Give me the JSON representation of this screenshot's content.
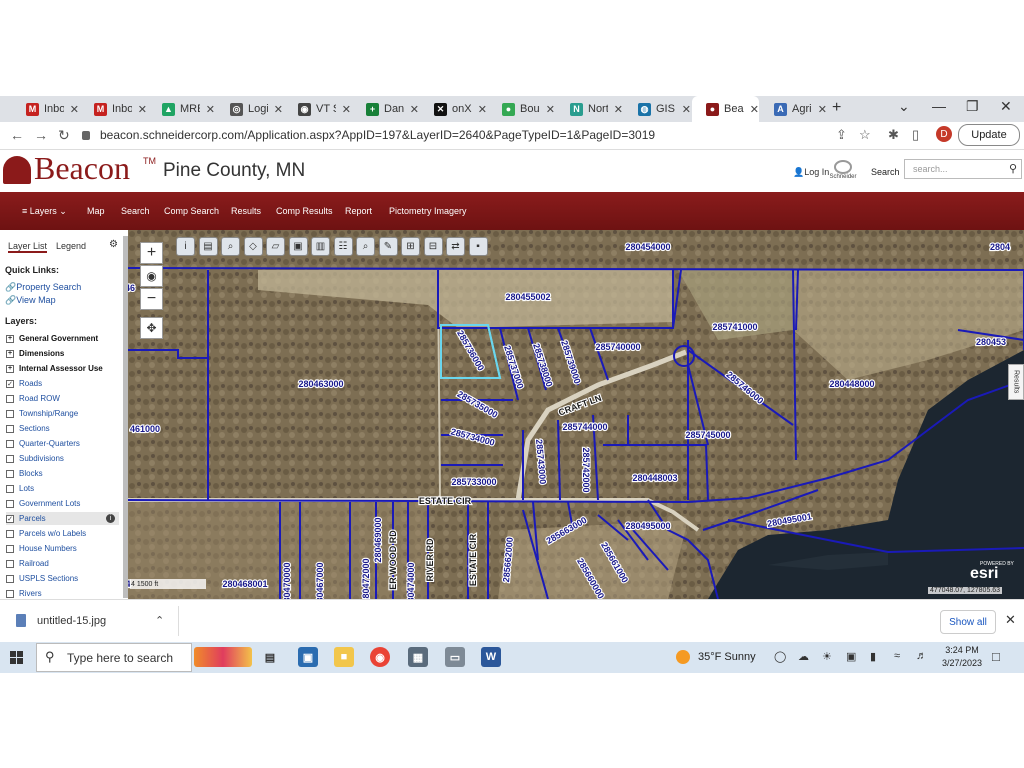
{
  "browser": {
    "tabs": [
      {
        "label": "Inbo",
        "icon": "gmail-icon",
        "color": "#c5221f",
        "glyph": "M"
      },
      {
        "label": "Inbo",
        "icon": "gmail-icon",
        "color": "#c5221f",
        "glyph": "M"
      },
      {
        "label": "MRE",
        "icon": "google-drive-icon",
        "color": "#1fa463",
        "glyph": "▲"
      },
      {
        "label": "Logi",
        "icon": "globe-icon",
        "color": "#555555",
        "glyph": "◎"
      },
      {
        "label": "VT S",
        "icon": "vt-icon",
        "color": "#444444",
        "glyph": "◉"
      },
      {
        "label": "Dan",
        "icon": "sheets-icon",
        "color": "#188038",
        "glyph": "+"
      },
      {
        "label": "onX",
        "icon": "onx-icon",
        "color": "#111111",
        "glyph": "✕"
      },
      {
        "label": "Boul",
        "icon": "maps-pin-icon",
        "color": "#34a853",
        "glyph": "●"
      },
      {
        "label": "Nort",
        "icon": "north-icon",
        "color": "#2a9d8f",
        "glyph": "N"
      },
      {
        "label": "GIS",
        "icon": "gis-globe-icon",
        "color": "#1a73a8",
        "glyph": "◍"
      },
      {
        "label": "Bea",
        "icon": "beacon-icon",
        "color": "#8b1a1a",
        "glyph": "●",
        "active": true
      },
      {
        "label": "Agri",
        "icon": "agri-icon",
        "color": "#3a6ab5",
        "glyph": "A"
      }
    ],
    "new_tab": "+",
    "url": "beacon.schneidercorp.com/Application.aspx?AppID=197&LayerID=2640&PageTypeID=1&PageID=3019",
    "profile_initial": "D",
    "update_label": "Update"
  },
  "header": {
    "logo_text": "Beacon",
    "trademark": "TM",
    "county": "Pine County, MN",
    "login": "Log In",
    "vendor": "Schneider",
    "search_label": "Search",
    "search_placeholder": "search..."
  },
  "nav": {
    "items": [
      "Layers",
      "Map",
      "Search",
      "Comp Search",
      "Results",
      "Comp Results",
      "Report",
      "Pictometry Imagery"
    ]
  },
  "sidebar": {
    "tab_layer_list": "Layer List",
    "tab_legend": "Legend",
    "quick_links_heading": "Quick Links:",
    "link_property_search": "Property Search",
    "link_view_map": "View Map",
    "layers_heading": "Layers:",
    "layers": [
      {
        "label": "General Government",
        "type": "group",
        "mark": "+"
      },
      {
        "label": "Dimensions",
        "type": "group",
        "mark": "+"
      },
      {
        "label": "Internal Assessor Use",
        "type": "group",
        "mark": "+"
      },
      {
        "label": "Roads",
        "type": "check",
        "checked": true
      },
      {
        "label": "Road ROW",
        "type": "check",
        "checked": false
      },
      {
        "label": "Township/Range",
        "type": "check",
        "checked": false
      },
      {
        "label": "Sections",
        "type": "check",
        "checked": false
      },
      {
        "label": "Quarter-Quarters",
        "type": "check",
        "checked": false
      },
      {
        "label": "Subdivisions",
        "type": "check",
        "checked": false
      },
      {
        "label": "Blocks",
        "type": "check",
        "checked": false
      },
      {
        "label": "Lots",
        "type": "check",
        "checked": false
      },
      {
        "label": "Government Lots",
        "type": "check",
        "checked": false
      },
      {
        "label": "Parcels",
        "type": "check",
        "checked": true,
        "selected": true
      },
      {
        "label": "Parcels w/o Labels",
        "type": "check",
        "checked": false
      },
      {
        "label": "House Numbers",
        "type": "check",
        "checked": false
      },
      {
        "label": "Railroad",
        "type": "check",
        "checked": false
      },
      {
        "label": "USPLS Sections",
        "type": "check",
        "checked": false
      },
      {
        "label": "Rivers",
        "type": "check",
        "checked": false
      }
    ]
  },
  "map": {
    "parcel_labels": [
      "280454000",
      "280455002",
      "285741000",
      "280463000",
      "285736000",
      "285737000",
      "285738000",
      "285739000",
      "285740000",
      "285746000",
      "280448000",
      "285735000",
      "285734000",
      "285744000",
      "285743000",
      "285745000",
      "285742000",
      "280448003",
      "285733000",
      "280495000",
      "280495001",
      "285663000",
      "285662000",
      "285661000",
      "285660000",
      "280468001",
      "280470000",
      "280467000",
      "280472000",
      "280469000",
      "280474000",
      "461000",
      "46",
      "280453",
      "2804",
      "4"
    ],
    "road_labels": [
      "CRAFT LN",
      "ESTATE CIR",
      "ESTATE CIR",
      "RIVER RD",
      "ER WOOD RD"
    ],
    "scale_text": "4 1500 ft",
    "coords": "477048.07, 127805.63",
    "esri_label": "esri",
    "esri_powered": "POWERED BY",
    "results_tab": "Results",
    "colors": {
      "parcel_line": "#1a1ab8",
      "selected_parcel": "#6ad6ee",
      "water": "#1c2630",
      "label_fill": "#1a1a8c"
    }
  },
  "download": {
    "filename": "untitled-15.jpg",
    "show_all": "Show all"
  },
  "taskbar": {
    "search_placeholder": "Type here to search",
    "weather": "35°F  Sunny",
    "time": "3:24 PM",
    "date": "3/27/2023"
  }
}
